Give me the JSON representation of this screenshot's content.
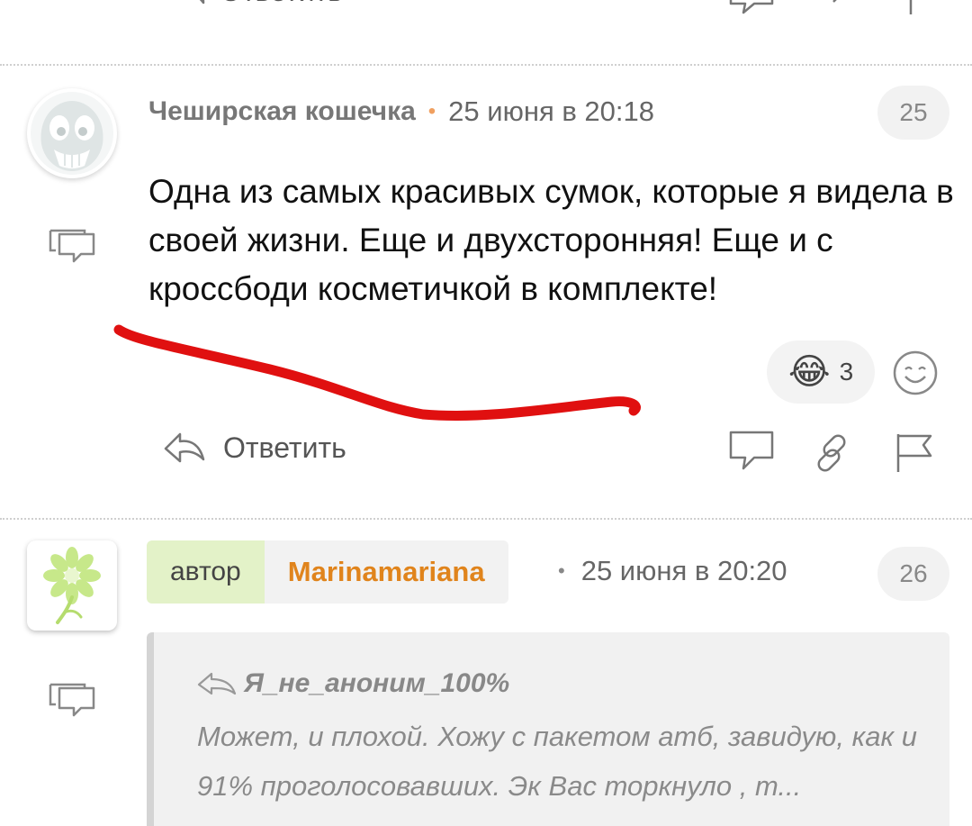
{
  "previous_comment": {
    "reply_label": "Ответить"
  },
  "comment1": {
    "author": "Чеширская кошечка",
    "time": "25 июня в 20:18",
    "number": "25",
    "text": "Одна из самых красивых сумок, которые я видела в своей жизни. Еще и двухсторонняя! Еще и с кроссбоди косметичкой в комплекте!",
    "reaction": {
      "emoji": "😂",
      "count": "3"
    },
    "reply_label": "Ответить"
  },
  "comment2": {
    "role_tag": "автор",
    "author": "Marinamariana",
    "time": "25 июня в 20:20",
    "number": "26",
    "quote": {
      "author": "Я_не_аноним_100%",
      "text": "Может, и плохой. Хожу с пакетом атб, завидую, как и 91% проголосовавших. Эк Вас торкнуло , т..."
    }
  },
  "colors": {
    "author_accent": "#e0841c",
    "role_tag_bg": "#e3f2c8",
    "annotation_stroke": "#e01010"
  }
}
